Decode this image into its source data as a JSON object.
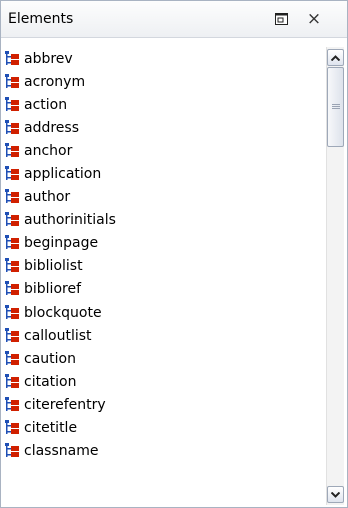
{
  "panel": {
    "title": "Elements",
    "close_glyph": "×"
  },
  "icons": {
    "restore": "restore-icon",
    "close": "close-icon",
    "element": "element-icon",
    "scroll_up": "chevron-up-icon",
    "scroll_down": "chevron-down-icon",
    "grip": "scroll-grip-icon"
  },
  "colors": {
    "icon_red": "#d02000",
    "icon_blue": "#1f4fb5"
  },
  "elements": [
    "abbrev",
    "acronym",
    "action",
    "address",
    "anchor",
    "application",
    "author",
    "authorinitials",
    "beginpage",
    "bibliolist",
    "biblioref",
    "blockquote",
    "calloutlist",
    "caution",
    "citation",
    "citerefentry",
    "citetitle",
    "classname"
  ]
}
